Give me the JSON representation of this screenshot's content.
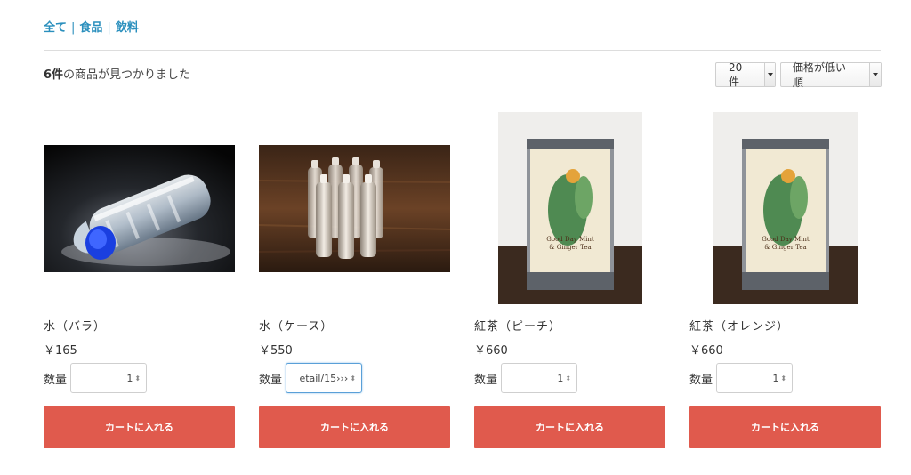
{
  "breadcrumbs": [
    "全て",
    "食品",
    "飲料"
  ],
  "result": {
    "count": "6件",
    "suffix": "の商品が見つかりました"
  },
  "per_page": {
    "value": "20件"
  },
  "sort": {
    "value": "価格が低い順"
  },
  "qty_label": "数量",
  "cart_label": "カートに入れる",
  "products": [
    {
      "name": "水（バラ）",
      "price": "￥165",
      "qty": "1"
    },
    {
      "name": "水（ケース）",
      "price": "￥550",
      "qty": "etail/15›››"
    },
    {
      "name": "紅茶（ピーチ）",
      "price": "￥660",
      "qty": "1"
    },
    {
      "name": "紅茶（オレンジ）",
      "price": "￥660",
      "qty": "1"
    }
  ],
  "colors": {
    "link": "#2a8fbd",
    "cart_button": "#e05a4d"
  }
}
